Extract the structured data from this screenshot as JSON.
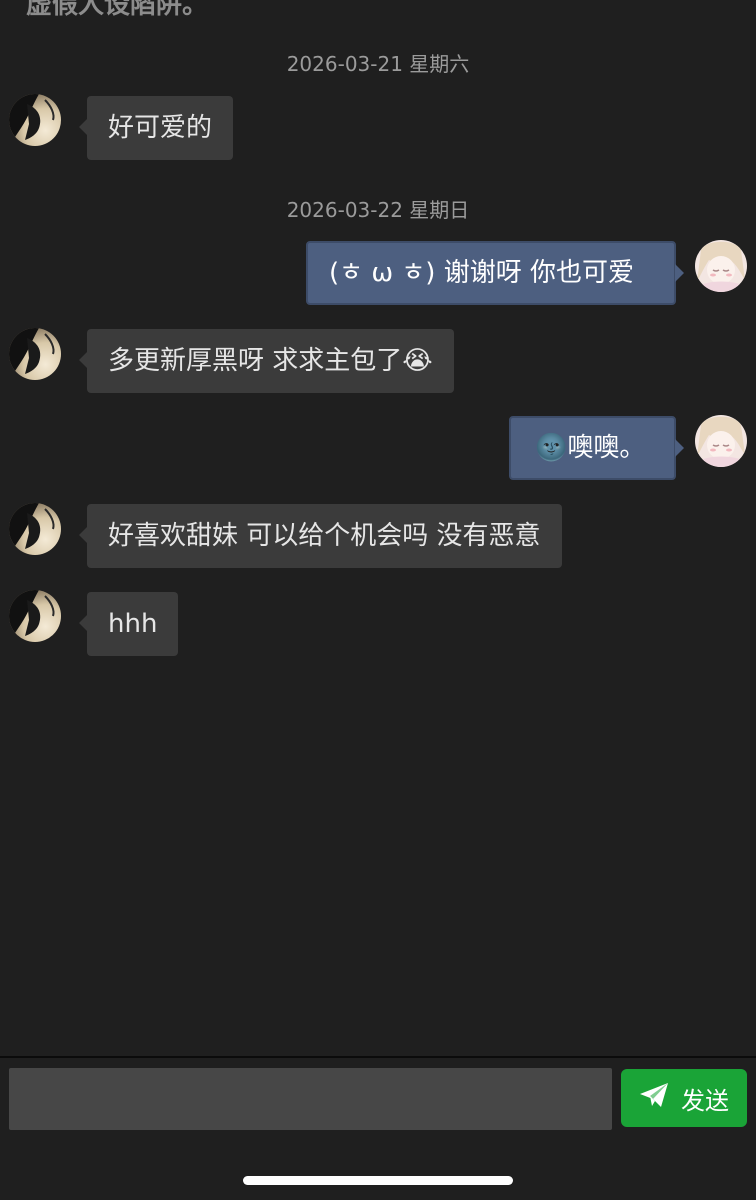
{
  "header": {
    "partial_text": "虚假人设陷阱。"
  },
  "timestamps": [
    "2026-03-21 星期六",
    "2026-03-22 星期日"
  ],
  "messages": [
    {
      "side": "left",
      "text": "好可爱的"
    },
    {
      "side": "right",
      "text": "(ㅎ ω ㅎ) 谢谢呀 你也可爱"
    },
    {
      "side": "left",
      "text": "多更新厚黑呀 求求主包了😭"
    },
    {
      "side": "right",
      "text": "🌚噢噢。"
    },
    {
      "side": "left",
      "text": "好喜欢甜妹 可以给个机会吗 没有恶意"
    },
    {
      "side": "left",
      "text": "hhh"
    }
  ],
  "composer": {
    "placeholder": "",
    "value": "",
    "send_label": "发送",
    "send_icon": "paper-plane-icon"
  },
  "colors": {
    "background": "#1f1f1f",
    "left_bubble": "#3b3b3b",
    "right_bubble": "#4d5f80",
    "send_button": "#1aa437",
    "input_field": "#474747"
  }
}
